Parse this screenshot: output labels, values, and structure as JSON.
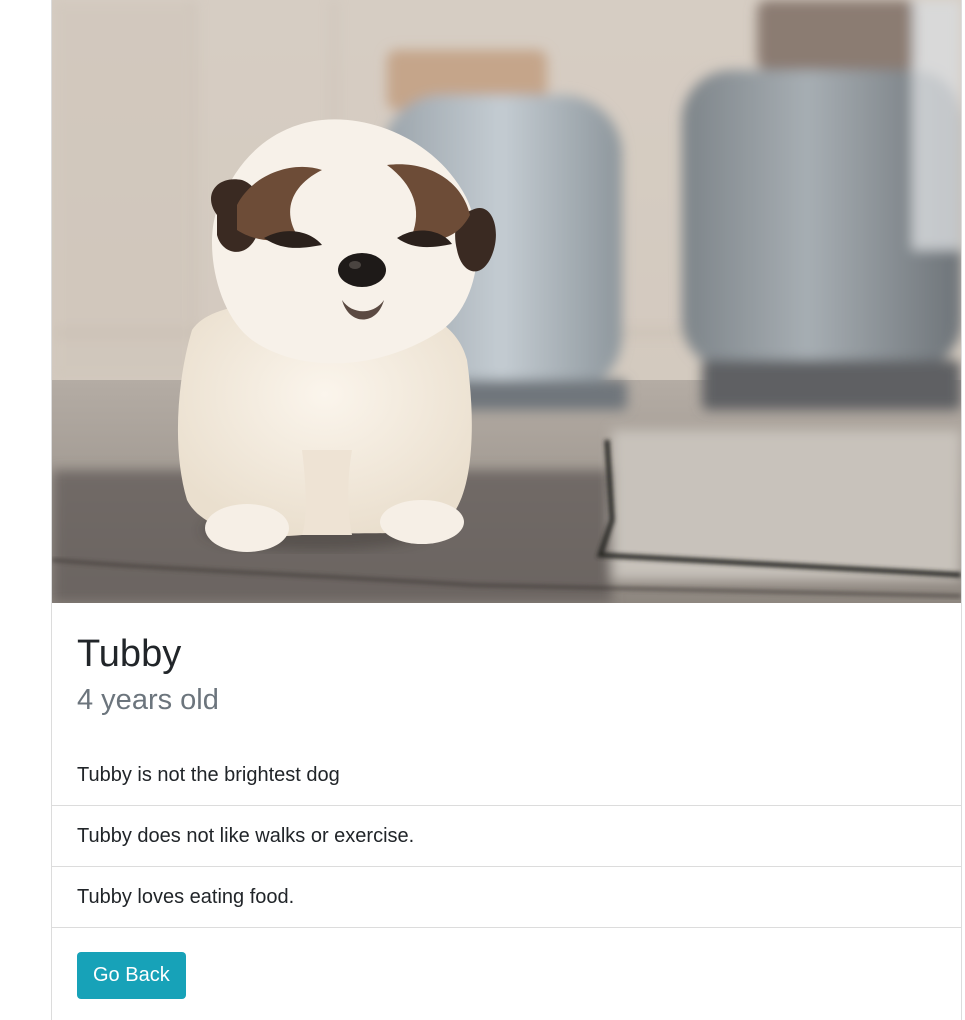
{
  "dog": {
    "name": "Tubby",
    "age": "4 years old",
    "image_alt": "Tubby",
    "facts": [
      "Tubby is not the brightest dog",
      "Tubby does not like walks or exercise.",
      "Tubby loves eating food."
    ]
  },
  "actions": {
    "back_label": "Go Back"
  },
  "colors": {
    "button": "#17a2b8",
    "subtitle": "#6c757d",
    "text": "#212529",
    "divider": "#dcdcdc"
  }
}
